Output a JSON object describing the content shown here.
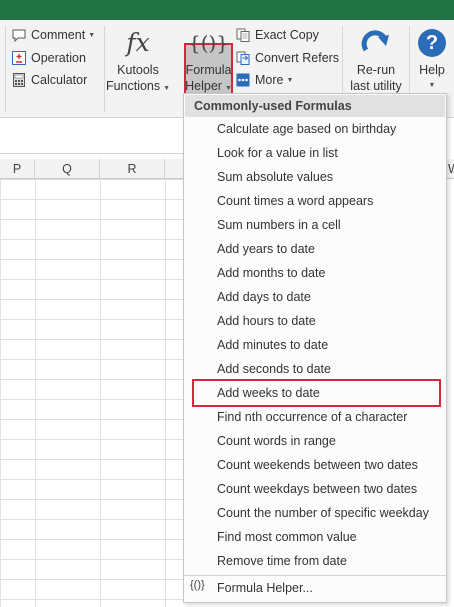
{
  "ribbon": {
    "comment_label": "Comment",
    "operation_label": "Operation",
    "calculator_label": "Calculator",
    "kutools_functions_line1": "Kutools",
    "kutools_functions_line2": "Functions",
    "kutools_functions_icon_text": "fx",
    "formula_helper_line1": "Formula",
    "formula_helper_line2": "Helper",
    "formula_helper_icon_text": "{()}",
    "exact_copy_label": "Exact Copy",
    "convert_refers_label": "Convert Refers",
    "more_label": "More",
    "rerun_line1": "Re-run",
    "rerun_line2": "last utility",
    "help_line1": "Help",
    "help_icon_text": "?"
  },
  "sheet": {
    "columns": [
      "P",
      "Q",
      "R",
      "W"
    ]
  },
  "menu": {
    "header": "Commonly-used Formulas",
    "items": [
      "Calculate age based on birthday",
      "Look for a value in list",
      "Sum absolute values",
      "Count times a word appears",
      "Sum numbers in a cell",
      "Add years to date",
      "Add months to date",
      "Add days to date",
      "Add hours to date",
      "Add minutes to date",
      "Add seconds to date",
      "Add weeks to date",
      "Find nth occurrence of a character",
      "Count words in range",
      "Count weekends between two dates",
      "Count weekdays between two dates",
      "Count the number of specific weekday",
      "Find most common value",
      "Remove time from date"
    ],
    "highlighted_item": "Add weeks to date",
    "footer_icon_text": "{()}",
    "footer_label": "Formula Helper..."
  },
  "colors": {
    "title_bar": "#217346",
    "highlight_border": "#d0293b",
    "ribbon_bg": "#f3f3f3",
    "menu_header_bg": "#e1e1e1"
  }
}
